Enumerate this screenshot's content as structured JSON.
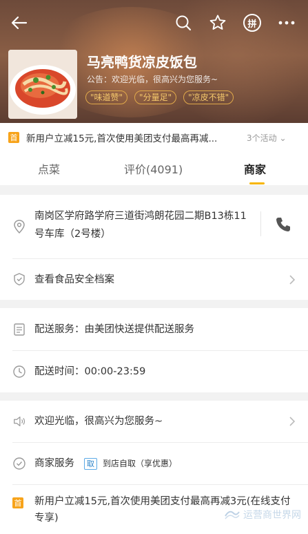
{
  "header": {
    "shop_name": "马亮鸭货凉皮饭包",
    "notice": "公告：欢迎光临，很高兴为您服务~",
    "tags": [
      "\"味道赞\"",
      "\"分量足\"",
      "\"凉皮不错\""
    ],
    "pin_label": "拼",
    "icons": [
      "back-arrow-icon",
      "search-icon",
      "star-icon",
      "pin-icon",
      "more-icon"
    ]
  },
  "promo": {
    "badge": "首",
    "text": "新用户立减15元,首次使用美团支付最高再减...",
    "more": "3个活动 ⌄"
  },
  "tabs": [
    {
      "label": "点菜"
    },
    {
      "label": "评价(4091)"
    },
    {
      "label": "商家",
      "active": true
    }
  ],
  "info": {
    "address": "南岗区学府路学府三道街鸿朗花园二期B13栋11号车库（2号楼）",
    "food_safety": "查看食品安全档案",
    "delivery_service": "配送服务：由美团快送提供配送服务",
    "delivery_time": "配送时间：00:00-23:59",
    "welcome": "欢迎光临，很高兴为您服务~",
    "merchant_service_label": "商家服务",
    "pickup_pill": "取",
    "pickup_text": "到店自取（享优惠）",
    "bottom_promo_badge": "首",
    "bottom_promo_text": "新用户立减15元,首次使用美团支付最高再减3元(在线支付专享)"
  },
  "watermark": "运营商世界网",
  "colors": {
    "accent": "#f7b500",
    "badge": "#f7a31a",
    "tag_text": "#f5c86b",
    "pill_blue": "#2d84c9"
  }
}
